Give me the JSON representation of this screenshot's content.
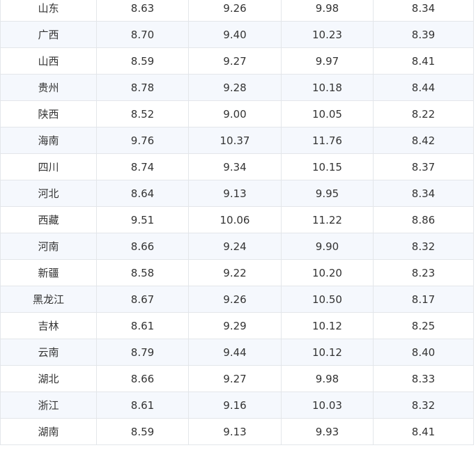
{
  "table": {
    "rows": [
      {
        "region": "山东",
        "values": [
          "8.63",
          "9.26",
          "9.98",
          "8.34"
        ]
      },
      {
        "region": "广西",
        "values": [
          "8.70",
          "9.40",
          "10.23",
          "8.39"
        ]
      },
      {
        "region": "山西",
        "values": [
          "8.59",
          "9.27",
          "9.97",
          "8.41"
        ]
      },
      {
        "region": "贵州",
        "values": [
          "8.78",
          "9.28",
          "10.18",
          "8.44"
        ]
      },
      {
        "region": "陕西",
        "values": [
          "8.52",
          "9.00",
          "10.05",
          "8.22"
        ]
      },
      {
        "region": "海南",
        "values": [
          "9.76",
          "10.37",
          "11.76",
          "8.42"
        ]
      },
      {
        "region": "四川",
        "values": [
          "8.74",
          "9.34",
          "10.15",
          "8.37"
        ]
      },
      {
        "region": "河北",
        "values": [
          "8.64",
          "9.13",
          "9.95",
          "8.34"
        ]
      },
      {
        "region": "西藏",
        "values": [
          "9.51",
          "10.06",
          "11.22",
          "8.86"
        ]
      },
      {
        "region": "河南",
        "values": [
          "8.66",
          "9.24",
          "9.90",
          "8.32"
        ]
      },
      {
        "region": "新疆",
        "values": [
          "8.58",
          "9.22",
          "10.20",
          "8.23"
        ]
      },
      {
        "region": "黑龙江",
        "values": [
          "8.67",
          "9.26",
          "10.50",
          "8.17"
        ]
      },
      {
        "region": "吉林",
        "values": [
          "8.61",
          "9.29",
          "10.12",
          "8.25"
        ]
      },
      {
        "region": "云南",
        "values": [
          "8.79",
          "9.44",
          "10.12",
          "8.40"
        ]
      },
      {
        "region": "湖北",
        "values": [
          "8.66",
          "9.27",
          "9.98",
          "8.33"
        ]
      },
      {
        "region": "浙江",
        "values": [
          "8.61",
          "9.16",
          "10.03",
          "8.32"
        ]
      },
      {
        "region": "湖南",
        "values": [
          "8.59",
          "9.13",
          "9.93",
          "8.41"
        ]
      }
    ]
  }
}
